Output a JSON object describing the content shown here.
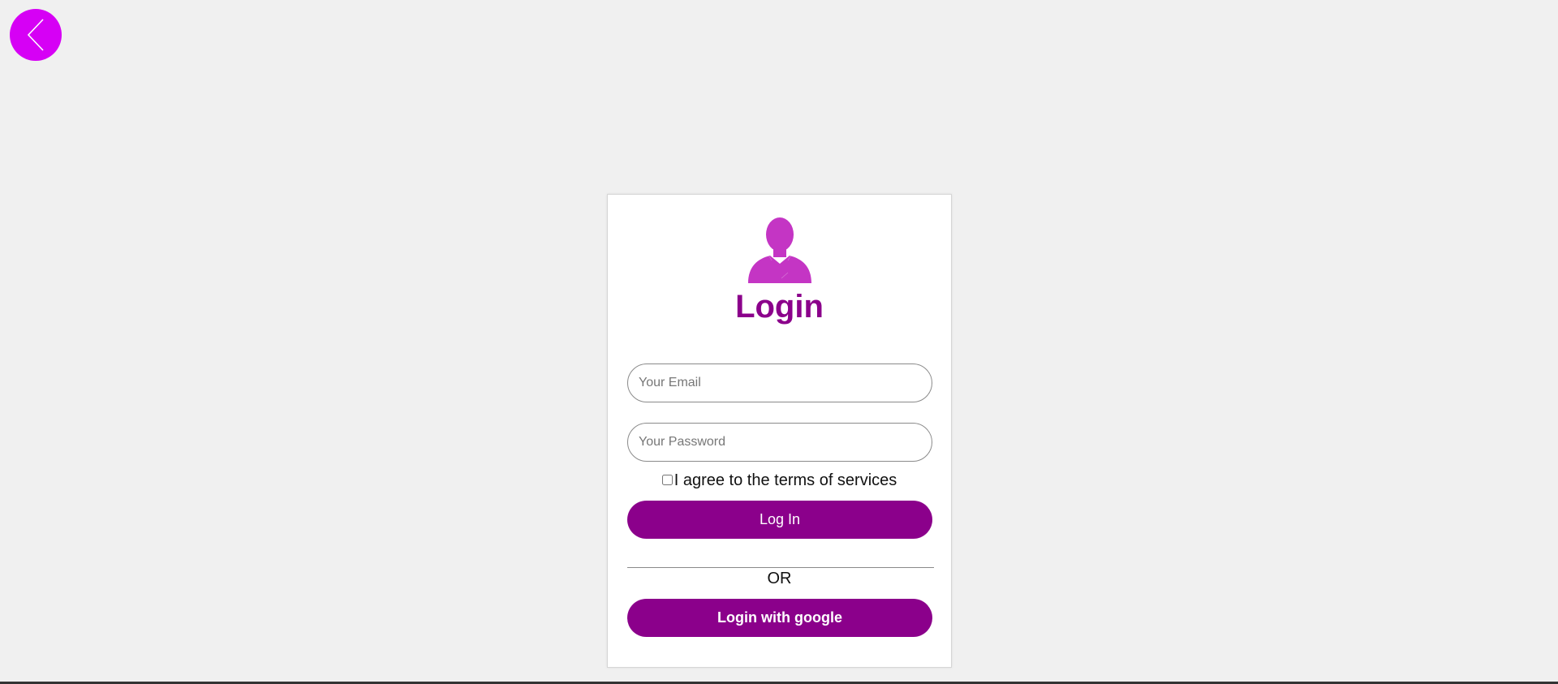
{
  "colors": {
    "page_background": "#f0f0f0",
    "back_button": "#d600f5",
    "accent": "#8b008b",
    "avatar": "#c435c4"
  },
  "header": {
    "back_icon": "chevron-left-icon"
  },
  "login_card": {
    "avatar_icon": "user-silhouette-icon",
    "title": "Login",
    "email": {
      "value": "",
      "placeholder": "Your Email"
    },
    "password": {
      "value": "",
      "placeholder": "Your Password"
    },
    "terms": {
      "checked": false,
      "label": "I agree to the terms of services"
    },
    "login_button_label": "Log In",
    "divider_text": "OR",
    "google_button_label": "Login with google"
  }
}
